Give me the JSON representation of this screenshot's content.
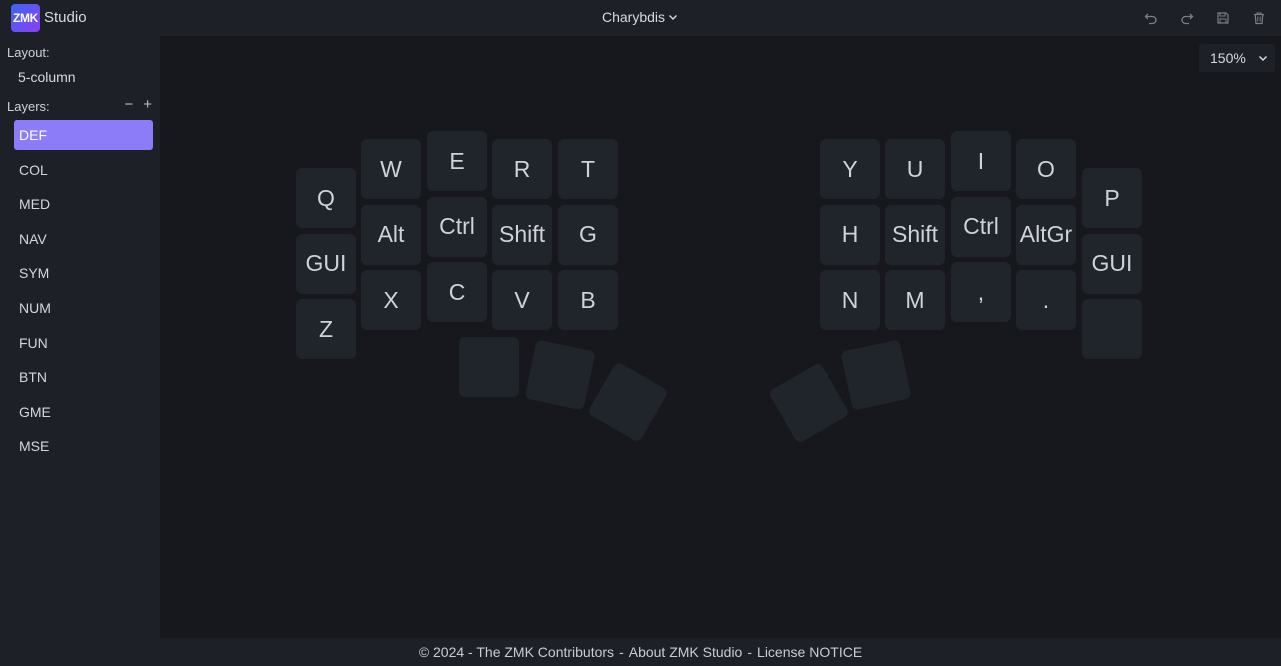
{
  "header": {
    "logo_text": "ZMK",
    "app_name": "Studio",
    "keyboard_name": "Charybdis",
    "icons": [
      "undo-icon",
      "redo-icon",
      "save-icon",
      "trash-icon"
    ]
  },
  "sidebar": {
    "layout_label": "Layout:",
    "layout_value": "5-column",
    "layers_label": "Layers:",
    "remove_symbol": "−",
    "add_symbol": "+",
    "layers": [
      {
        "label": "DEF",
        "active": true
      },
      {
        "label": "COL",
        "active": false
      },
      {
        "label": "MED",
        "active": false
      },
      {
        "label": "NAV",
        "active": false
      },
      {
        "label": "SYM",
        "active": false
      },
      {
        "label": "NUM",
        "active": false
      },
      {
        "label": "FUN",
        "active": false
      },
      {
        "label": "BTN",
        "active": false
      },
      {
        "label": "GME",
        "active": false
      },
      {
        "label": "MSE",
        "active": false
      }
    ]
  },
  "zoom": {
    "value": "150%"
  },
  "keymap": {
    "left": [
      [
        "Q",
        "W",
        "E",
        "R",
        "T"
      ],
      [
        "GUI",
        "Alt",
        "Ctrl",
        "Shift",
        "G"
      ],
      [
        "Z",
        "X",
        "C",
        "V",
        "B"
      ]
    ],
    "left_thumbs": [
      "",
      "",
      ""
    ],
    "right": [
      [
        "Y",
        "U",
        "I",
        "O",
        "P"
      ],
      [
        "H",
        "Shift",
        "Ctrl",
        "AltGr",
        "GUI"
      ],
      [
        "N",
        "M",
        ",",
        ".",
        ""
      ]
    ],
    "right_thumbs": [
      "",
      ""
    ]
  },
  "footer": {
    "copyright": "© 2024 - The ZMK Contributors",
    "separator": "-",
    "about": "About ZMK Studio",
    "license": "License",
    "notice": "NOTICE"
  },
  "colors": {
    "background": "#16181d",
    "panel": "#1d2027",
    "key": "#20242b",
    "accent": "#8c7cf7"
  }
}
